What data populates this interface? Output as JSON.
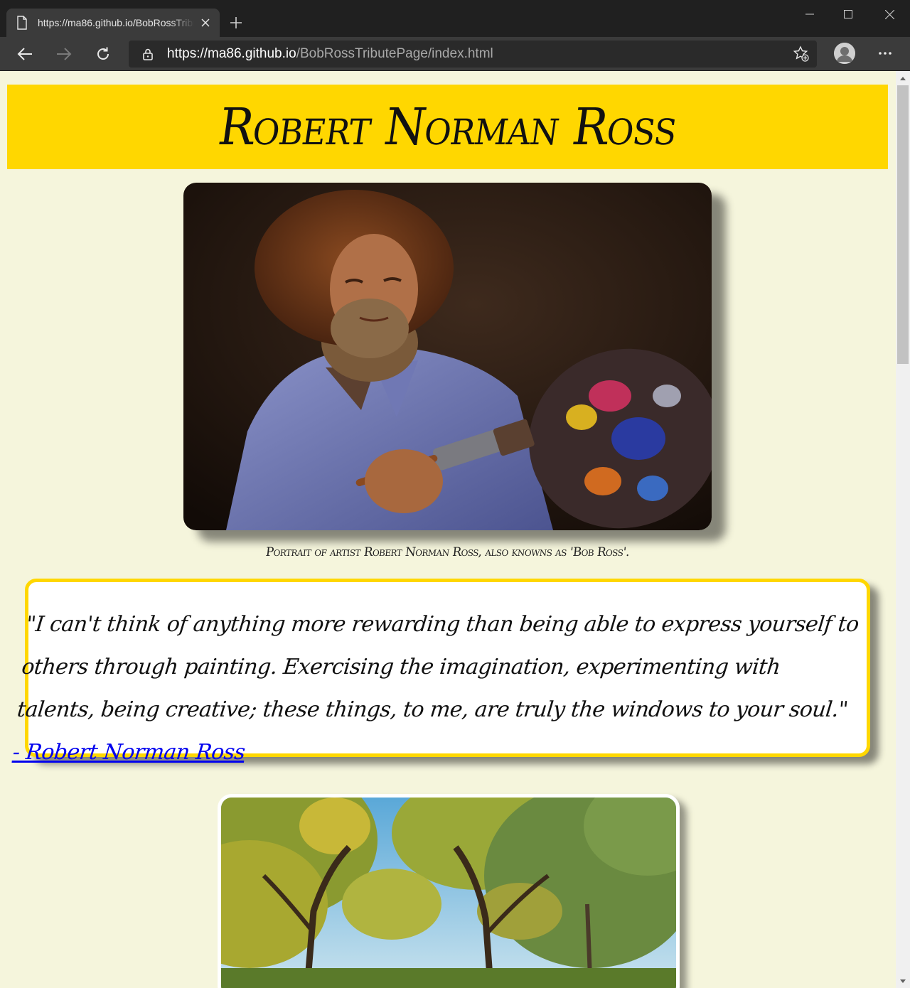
{
  "browser": {
    "tab_title": "https://ma86.github.io/BobRossTributePage/index.html",
    "url_scheme": "https://",
    "url_host": "ma86.github.io",
    "url_path": "/BobRossTributePage/index.html"
  },
  "page": {
    "title": "Robert Norman Ross",
    "portrait_alt": "Portrait of artist Robert Norman Ross",
    "caption": "Portrait of artist Robert Norman Ross, also knowns as 'Bob Ross'.",
    "quote": "\"I can't think of anything more rewarding than being able to express yourself to others through painting. Exercising the imagination, experimenting with talents, being creative; these things, to me, are truly the windows to your soul.\"",
    "quote_author": "- Robert Norman Ross",
    "landscape_alt": "Bob Ross landscape painting"
  },
  "colors": {
    "header_bg": "#ffd700",
    "page_bg": "#f5f5dc",
    "quote_border": "#ffd700",
    "link": "#0000ee"
  }
}
